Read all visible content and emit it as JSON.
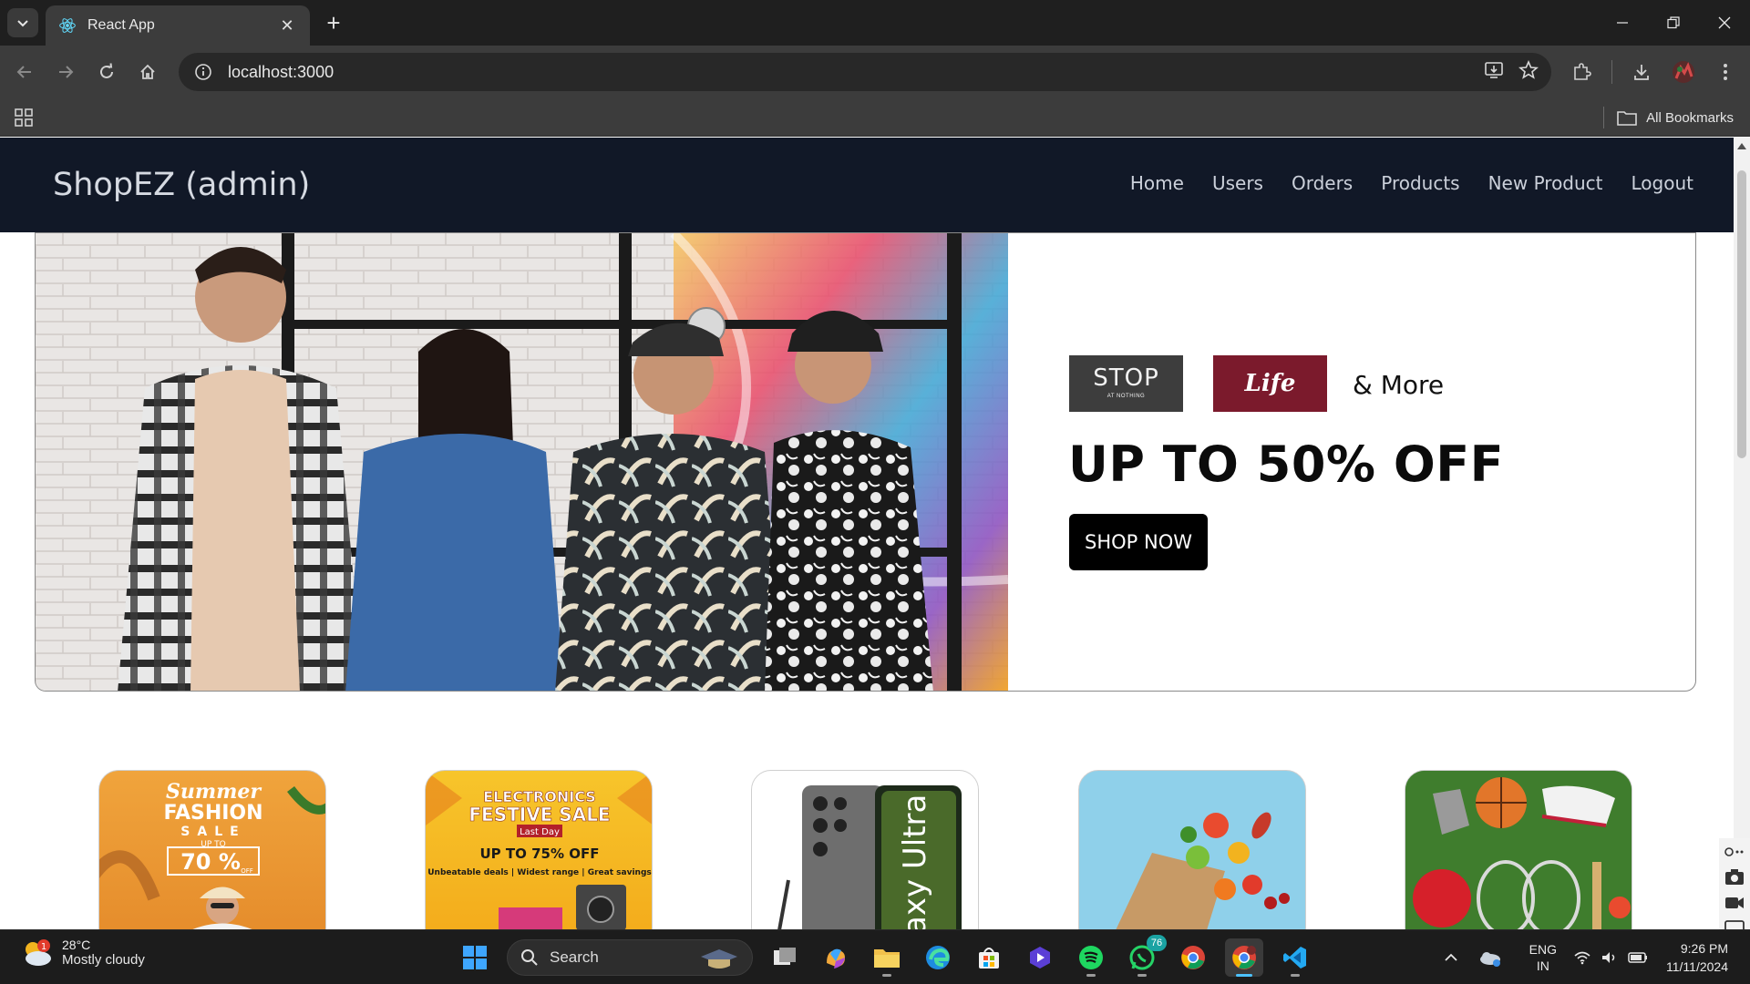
{
  "browser": {
    "tab_title": "React App",
    "url": "localhost:3000",
    "all_bookmarks_label": "All Bookmarks"
  },
  "navbar": {
    "brand": "ShopEZ (admin)",
    "links": [
      "Home",
      "Users",
      "Orders",
      "Products",
      "New Product",
      "Logout"
    ]
  },
  "hero": {
    "brand_stop": "STOP",
    "brand_stop_tagline": "AT NOTHING",
    "brand_life": "Life",
    "brand_more": "&  More",
    "offer": "UP TO 50% OFF",
    "cta": "SHOP NOW"
  },
  "categories": [
    {
      "name": "fashion",
      "title": "Summer",
      "subtitle": "FASHION",
      "line3": "SALE",
      "tag": "UP TO",
      "value": "70 %",
      "unit": "OFF"
    },
    {
      "name": "electronics",
      "title": "ELECTRONICS",
      "subtitle": "FESTIVE SALE",
      "badge": "Last Day",
      "offer": "UP TO 75% OFF",
      "tagline": "Unbeatable deals | Widest range | Great savings"
    },
    {
      "name": "mobiles",
      "text": "axy Ultra"
    },
    {
      "name": "groceries"
    },
    {
      "name": "sports"
    }
  ],
  "taskbar": {
    "weather_temp": "28°C",
    "weather_cond": "Mostly cloudy",
    "weather_badge": "1",
    "search_label": "Search",
    "whatsapp_badge": "76",
    "lang_top": "ENG",
    "lang_bottom": "IN",
    "time": "9:26 PM",
    "date": "11/11/2024"
  },
  "colors": {
    "navbar_bg": "#111827",
    "chrome_dark": "#1f1f1f",
    "chrome_toolbar": "#3c3c3c",
    "life_brand": "#7b1a2c",
    "stop_brand": "#3d3d3d"
  }
}
